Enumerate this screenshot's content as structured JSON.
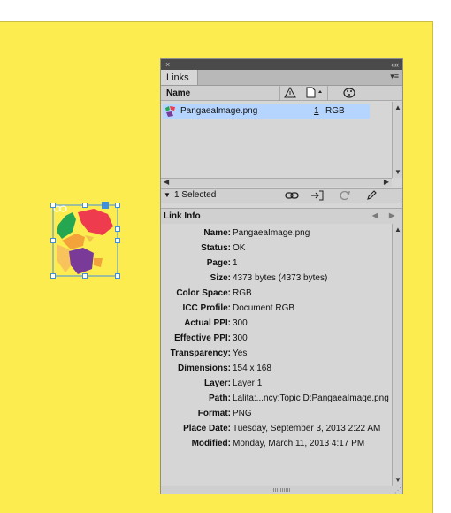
{
  "panel": {
    "close_glyph": "×",
    "collapse_glyph": "««",
    "tab_label": "Links",
    "menu_glyph": "▾≡",
    "columns": {
      "name": "Name",
      "status_icon": "warning-icon",
      "page_icon": "page-icon",
      "colorspace_icon": "palette-icon"
    },
    "links": [
      {
        "filename": "PangaeaImage.png",
        "page": "1",
        "color_space": "RGB",
        "selected": true
      }
    ],
    "status": {
      "selected_text": "1 Selected",
      "buttons": [
        "relink-icon",
        "goto-link-icon",
        "update-link-icon",
        "edit-original-icon"
      ]
    },
    "info": {
      "title": "Link Info",
      "rows": [
        {
          "label": "Name:",
          "value": "PangaeaImage.png"
        },
        {
          "label": "Status:",
          "value": "OK"
        },
        {
          "label": "Page:",
          "value": "1"
        },
        {
          "label": "Size:",
          "value": "4373 bytes (4373 bytes)"
        },
        {
          "label": "Color Space:",
          "value": "RGB"
        },
        {
          "label": "ICC Profile:",
          "value": "Document RGB"
        },
        {
          "label": "Actual PPI:",
          "value": "300"
        },
        {
          "label": "Effective PPI:",
          "value": "300"
        },
        {
          "label": "Transparency:",
          "value": "Yes"
        },
        {
          "label": "Dimensions:",
          "value": "154 x 168"
        },
        {
          "label": "Layer:",
          "value": "Layer 1"
        },
        {
          "label": "Path:",
          "value": "Lalita:...ncy:Topic D:PangaeaImage.png"
        },
        {
          "label": "Format:",
          "value": "PNG"
        },
        {
          "label": "Place Date:",
          "value": "Tuesday, September 3, 2013 2:22 AM"
        },
        {
          "label": "Modified:",
          "value": "Monday, March 11, 2013 4:17 PM"
        }
      ]
    }
  },
  "colors": {
    "canvas": "#fdec50",
    "selection": "#3d8fe0",
    "row_highlight": "#b5d5ff"
  }
}
